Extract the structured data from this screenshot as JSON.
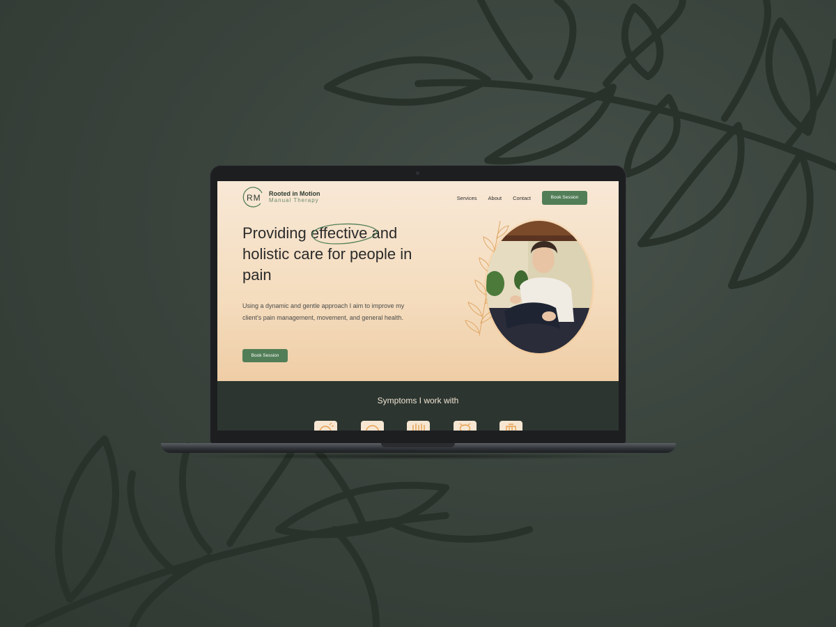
{
  "site": {
    "logo": {
      "initials": "RM",
      "title": "Rooted in Motion",
      "subtitle": "Manual Therapy"
    },
    "nav": {
      "items": [
        "Services",
        "About",
        "Contact"
      ],
      "cta": "Book Session"
    },
    "hero": {
      "headline_before": "Providing ",
      "headline_highlight": "effective",
      "headline_after": " and holistic care for people in pain",
      "paragraph": "Using a dynamic and gentle approach I aim to improve my client's pain management, movement, and general health.",
      "cta": "Book Session"
    },
    "symptoms": {
      "title": "Symptoms I work with",
      "icons": [
        "headache-icon",
        "stress-icon",
        "muscle-tension-icon",
        "back-pain-icon",
        "joint-pain-icon"
      ]
    }
  },
  "colors": {
    "page_background": "#3a443d",
    "leaf_outline": "#28322a",
    "hero_background": "#f4dcbd",
    "accent_green": "#527e57",
    "dark_section": "#2c3530",
    "icon_orange": "#e8a050"
  }
}
